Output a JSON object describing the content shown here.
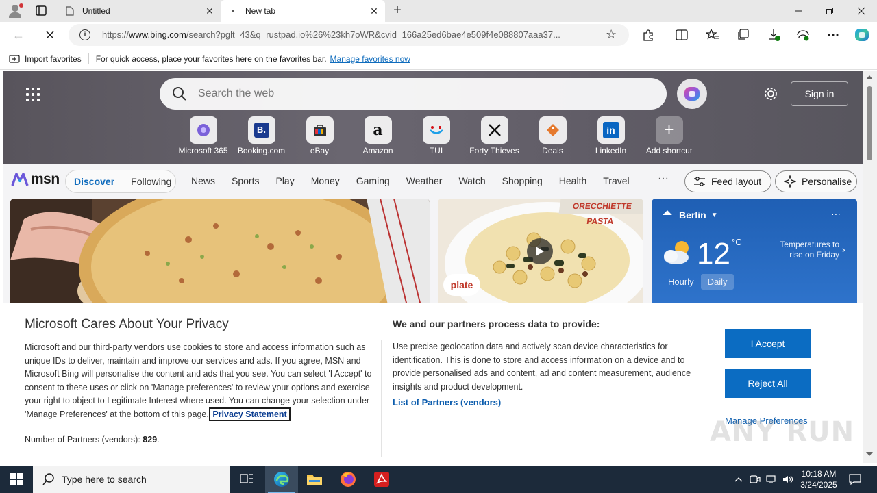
{
  "browser": {
    "tabs": [
      {
        "title": "Untitled",
        "active": false
      },
      {
        "title": "New tab",
        "active": true
      }
    ],
    "address": {
      "url_prefix": "https://",
      "url_host": "www.bing.com",
      "url_rest": "/search?pglt=43&q=rustpad.io%26%23kh7oWR&cvid=166a25ed6bae4e509f4e088807aaa37..."
    },
    "favorites_bar": {
      "import_label": "Import favorites",
      "hint": "For quick access, place your favorites here on the favorites bar.",
      "manage_link": "Manage favorites now"
    }
  },
  "msn": {
    "search_placeholder": "Search the web",
    "sign_in": "Sign in",
    "shortcuts": [
      {
        "label": "Microsoft 365",
        "icon": "m365-icon"
      },
      {
        "label": "Booking.com",
        "icon": "booking-icon"
      },
      {
        "label": "eBay",
        "icon": "ebay-icon"
      },
      {
        "label": "Amazon",
        "icon": "amazon-icon"
      },
      {
        "label": "TUI",
        "icon": "tui-icon"
      },
      {
        "label": "Forty Thieves",
        "icon": "forty-thieves-icon"
      },
      {
        "label": "Deals",
        "icon": "deals-icon"
      },
      {
        "label": "LinkedIn",
        "icon": "linkedin-icon"
      },
      {
        "label": "Add shortcut",
        "icon": "plus-icon"
      }
    ],
    "logo": "msn",
    "feed_tabs": {
      "discover": "Discover",
      "following": "Following"
    },
    "nav": [
      "News",
      "Sports",
      "Play",
      "Money",
      "Gaming",
      "Weather",
      "Watch",
      "Shopping",
      "Health",
      "Travel"
    ],
    "more": "···",
    "feed_layout": "Feed layout",
    "personalise": "Personalise",
    "pasta_banner": "ORECCHIETTE PASTA",
    "pasta_brand": "plate",
    "weather": {
      "city": "Berlin",
      "temp": "12",
      "unit": "°C",
      "note": "Temperatures to rise on Friday",
      "tabs": [
        "Hourly",
        "Daily"
      ]
    }
  },
  "privacy": {
    "title": "Microsoft Cares About Your Privacy",
    "body": "Microsoft and our third-party vendors use cookies to store and access information such as unique IDs to deliver, maintain and improve our services and ads. If you agree, MSN and Microsoft Bing will personalise the content and ads that you see. You can select 'I Accept' to consent to these uses or click on 'Manage preferences' to review your options and exercise your right to object to Legitimate Interest where used.  You can change your selection under 'Manage Preferences' at the bottom of this page.",
    "privacy_link": "Privacy Statement",
    "partners_label": "Number of Partners (vendors):",
    "partners_count": "829",
    "subheading": "We and our partners process data to provide:",
    "body2": "Use precise geolocation data and actively scan device characteristics for identification. This is done to store and access information on a device and to provide personalised ads and content, ad and content measurement, audience insights and product development.",
    "list_link": "List of Partners (vendors)",
    "accept": "I Accept",
    "reject": "Reject All",
    "manage": "Manage Preferences"
  },
  "watermark": "ANY RUN",
  "taskbar": {
    "search_placeholder": "Type here to search",
    "time": "10:18 AM",
    "date": "3/24/2025"
  },
  "colors": {
    "accent": "#0b6cc2",
    "link": "#0f6cbd",
    "weather_card": "#2f74cc",
    "taskbar": "#1c2a3a"
  }
}
